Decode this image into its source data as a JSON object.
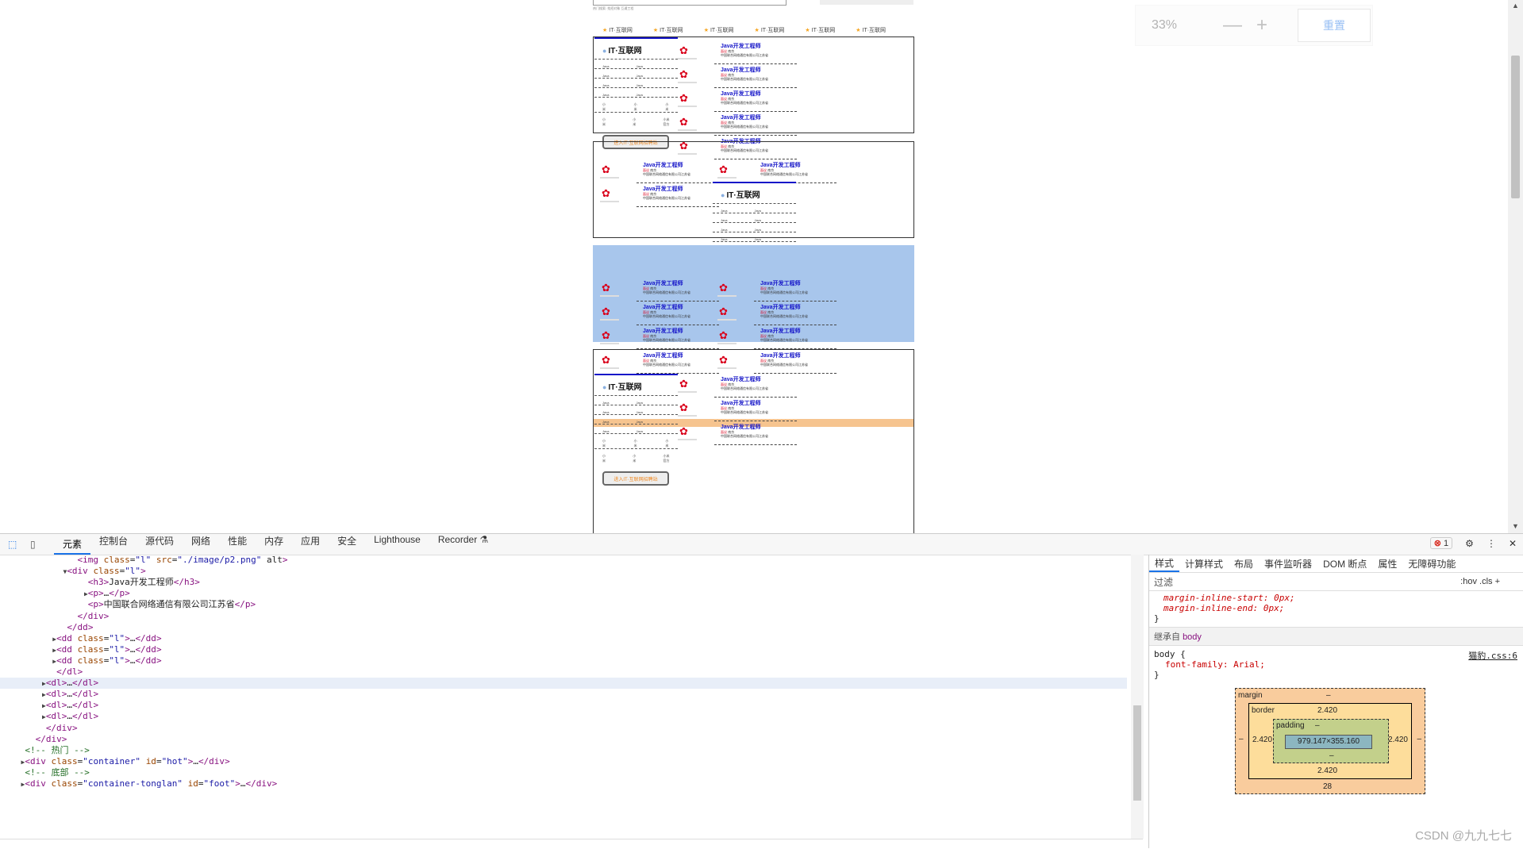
{
  "viewport": {
    "zoom": {
      "percent": "33%",
      "minus": "—",
      "plus": "+",
      "reset": "重置"
    },
    "hint_text": "热门搜索: 找招对象   互通工程",
    "top_links": [
      "IT·互联网",
      "IT·互联网",
      "IT·互联网",
      "IT·互联网",
      "IT·互联网",
      "IT·互联网"
    ],
    "job": {
      "title": "Java开发工程师",
      "tag": "面议",
      "place": "南京",
      "company": "中国联合网络通信有限公司江苏省"
    },
    "card": {
      "title": "IT·互联网",
      "rows": [
        [
          "Java",
          "Java"
        ],
        [
          "Java",
          "Java"
        ],
        [
          "Java",
          "Java"
        ],
        [
          "Java",
          "Java"
        ],
        [
          "小米",
          "小米",
          "小米"
        ],
        [
          "小米",
          "小米",
          "小米官方"
        ]
      ],
      "button": "进入IT·互联网招聘站"
    }
  },
  "devtools": {
    "tabs": [
      "元素",
      "控制台",
      "源代码",
      "网络",
      "性能",
      "内存",
      "应用",
      "安全",
      "Lighthouse",
      "Recorder ⚗"
    ],
    "error_count": "1",
    "code_lines": [
      {
        "indent": 8,
        "html": "<img class=\"l\" src=\"./image/p2.png\" alt>",
        "tri": ""
      },
      {
        "indent": 7,
        "html": "<div class=\"l\">",
        "tri": "▼"
      },
      {
        "indent": 9,
        "html": "<h3>Java开发工程师</h3>",
        "tri": ""
      },
      {
        "indent": 9,
        "html": "<p>…</p>",
        "tri": "▶"
      },
      {
        "indent": 9,
        "html": "<p>中国联合网络通信有限公司江苏省</p>",
        "tri": ""
      },
      {
        "indent": 8,
        "html": "</div>",
        "tri": ""
      },
      {
        "indent": 7,
        "html": "</dd>",
        "tri": ""
      },
      {
        "indent": 6,
        "html": "<dd class=\"l\">…</dd>",
        "tri": "▶"
      },
      {
        "indent": 6,
        "html": "<dd class=\"l\">…</dd>",
        "tri": "▶"
      },
      {
        "indent": 6,
        "html": "<dd class=\"l\">…</dd>",
        "tri": "▶"
      },
      {
        "indent": 6,
        "html": "</dl>",
        "tri": ""
      },
      {
        "indent": 5,
        "html": "<dl>…</dl>",
        "tri": "▶",
        "selected": true
      },
      {
        "indent": 5,
        "html": "<dl>…</dl>",
        "tri": "▶"
      },
      {
        "indent": 5,
        "html": "<dl>…</dl>",
        "tri": "▶"
      },
      {
        "indent": 5,
        "html": "<dl>…</dl>",
        "tri": "▶"
      },
      {
        "indent": 5,
        "html": "</div>",
        "tri": ""
      },
      {
        "indent": 4,
        "html": "</div>",
        "tri": ""
      },
      {
        "indent": 3,
        "html": "<!-- 热门 -->",
        "tri": "",
        "comment": true
      },
      {
        "indent": 3,
        "html": "<div class=\"container\" id=\"hot\">…</div>",
        "tri": "▶"
      },
      {
        "indent": 3,
        "html": "<!-- 底部 -->",
        "tri": "",
        "comment": true
      },
      {
        "indent": 3,
        "html": "<div class=\"container-tonglan\" id=\"foot\">…</div>",
        "tri": "▶"
      }
    ],
    "styles": {
      "tabs": [
        "样式",
        "计算样式",
        "布局",
        "事件监听器",
        "DOM 断点",
        "属性",
        "无障碍功能"
      ],
      "filter_placeholder": "过滤",
      "filter_opts": ":hov  .cls  +",
      "prop1": "margin-inline-start: 0px;",
      "prop2": "margin-inline-end: 0px;",
      "inherited_label": "继承自",
      "inherited_from": "body",
      "rule_selector": "body {",
      "rule_source": "猫豹.css:6",
      "rule_prop": "font-family: Arial;",
      "box": {
        "margin": "margin",
        "margin_val": "–",
        "margin_bottom": "28",
        "border": "border",
        "border_val": "2.420",
        "padding": "padding",
        "padding_val": "–",
        "content": "979.147×355.160"
      }
    }
  },
  "watermark": "CSDN @九九七七"
}
